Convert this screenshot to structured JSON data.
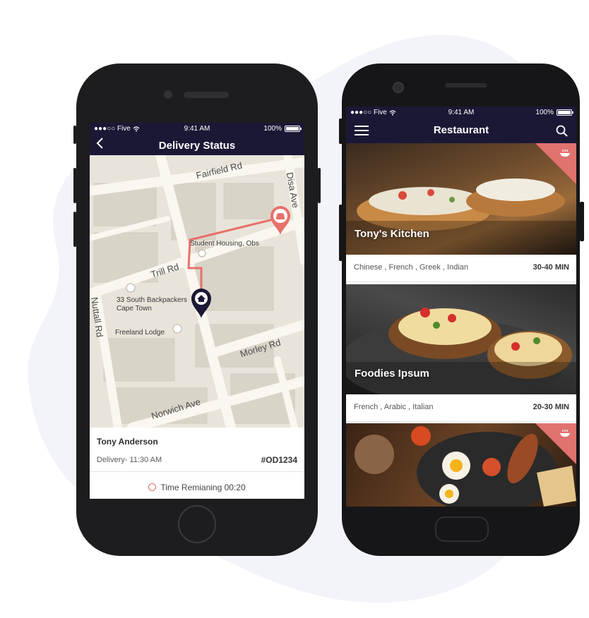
{
  "colors": {
    "navbar": "#1b1836",
    "accent": "#e0726f",
    "map_bg": "#e8e4da",
    "route": "#e8706b",
    "pin": "#1b1836"
  },
  "status_bar": {
    "carrier": "●●●○○ Five",
    "time": "9:41 AM",
    "battery": "100%"
  },
  "delivery": {
    "title": "Delivery Status",
    "map": {
      "roads": [
        "Fairfield Rd",
        "Disa Ave",
        "Trill Rd",
        "Nuttall Rd",
        "Morley Rd",
        "Norwich Ave"
      ],
      "places": [
        "Student Housing, Obs",
        "33 South Backpackers",
        "Cape Town",
        "Freeland Lodge"
      ]
    },
    "customer_name": "Tony Anderson",
    "delivery_time": "Delivery- 11:30 AM",
    "order_id": "#OD1234",
    "time_remaining": "Time Remianing 00:20"
  },
  "restaurant": {
    "title": "Restaurant",
    "items": [
      {
        "name": "Tony's Kitchen",
        "cuisines": "Chinese , French , Greek , Indian",
        "eta": "30-40 MIN",
        "ribbon_icon": "dish-icon"
      },
      {
        "name": "Foodies Ipsum",
        "cuisines": "French , Arabic , Italian",
        "eta": "20-30 MIN"
      },
      {
        "name": "",
        "cuisines": "",
        "eta": "",
        "ribbon_icon": "dish-icon"
      }
    ]
  }
}
